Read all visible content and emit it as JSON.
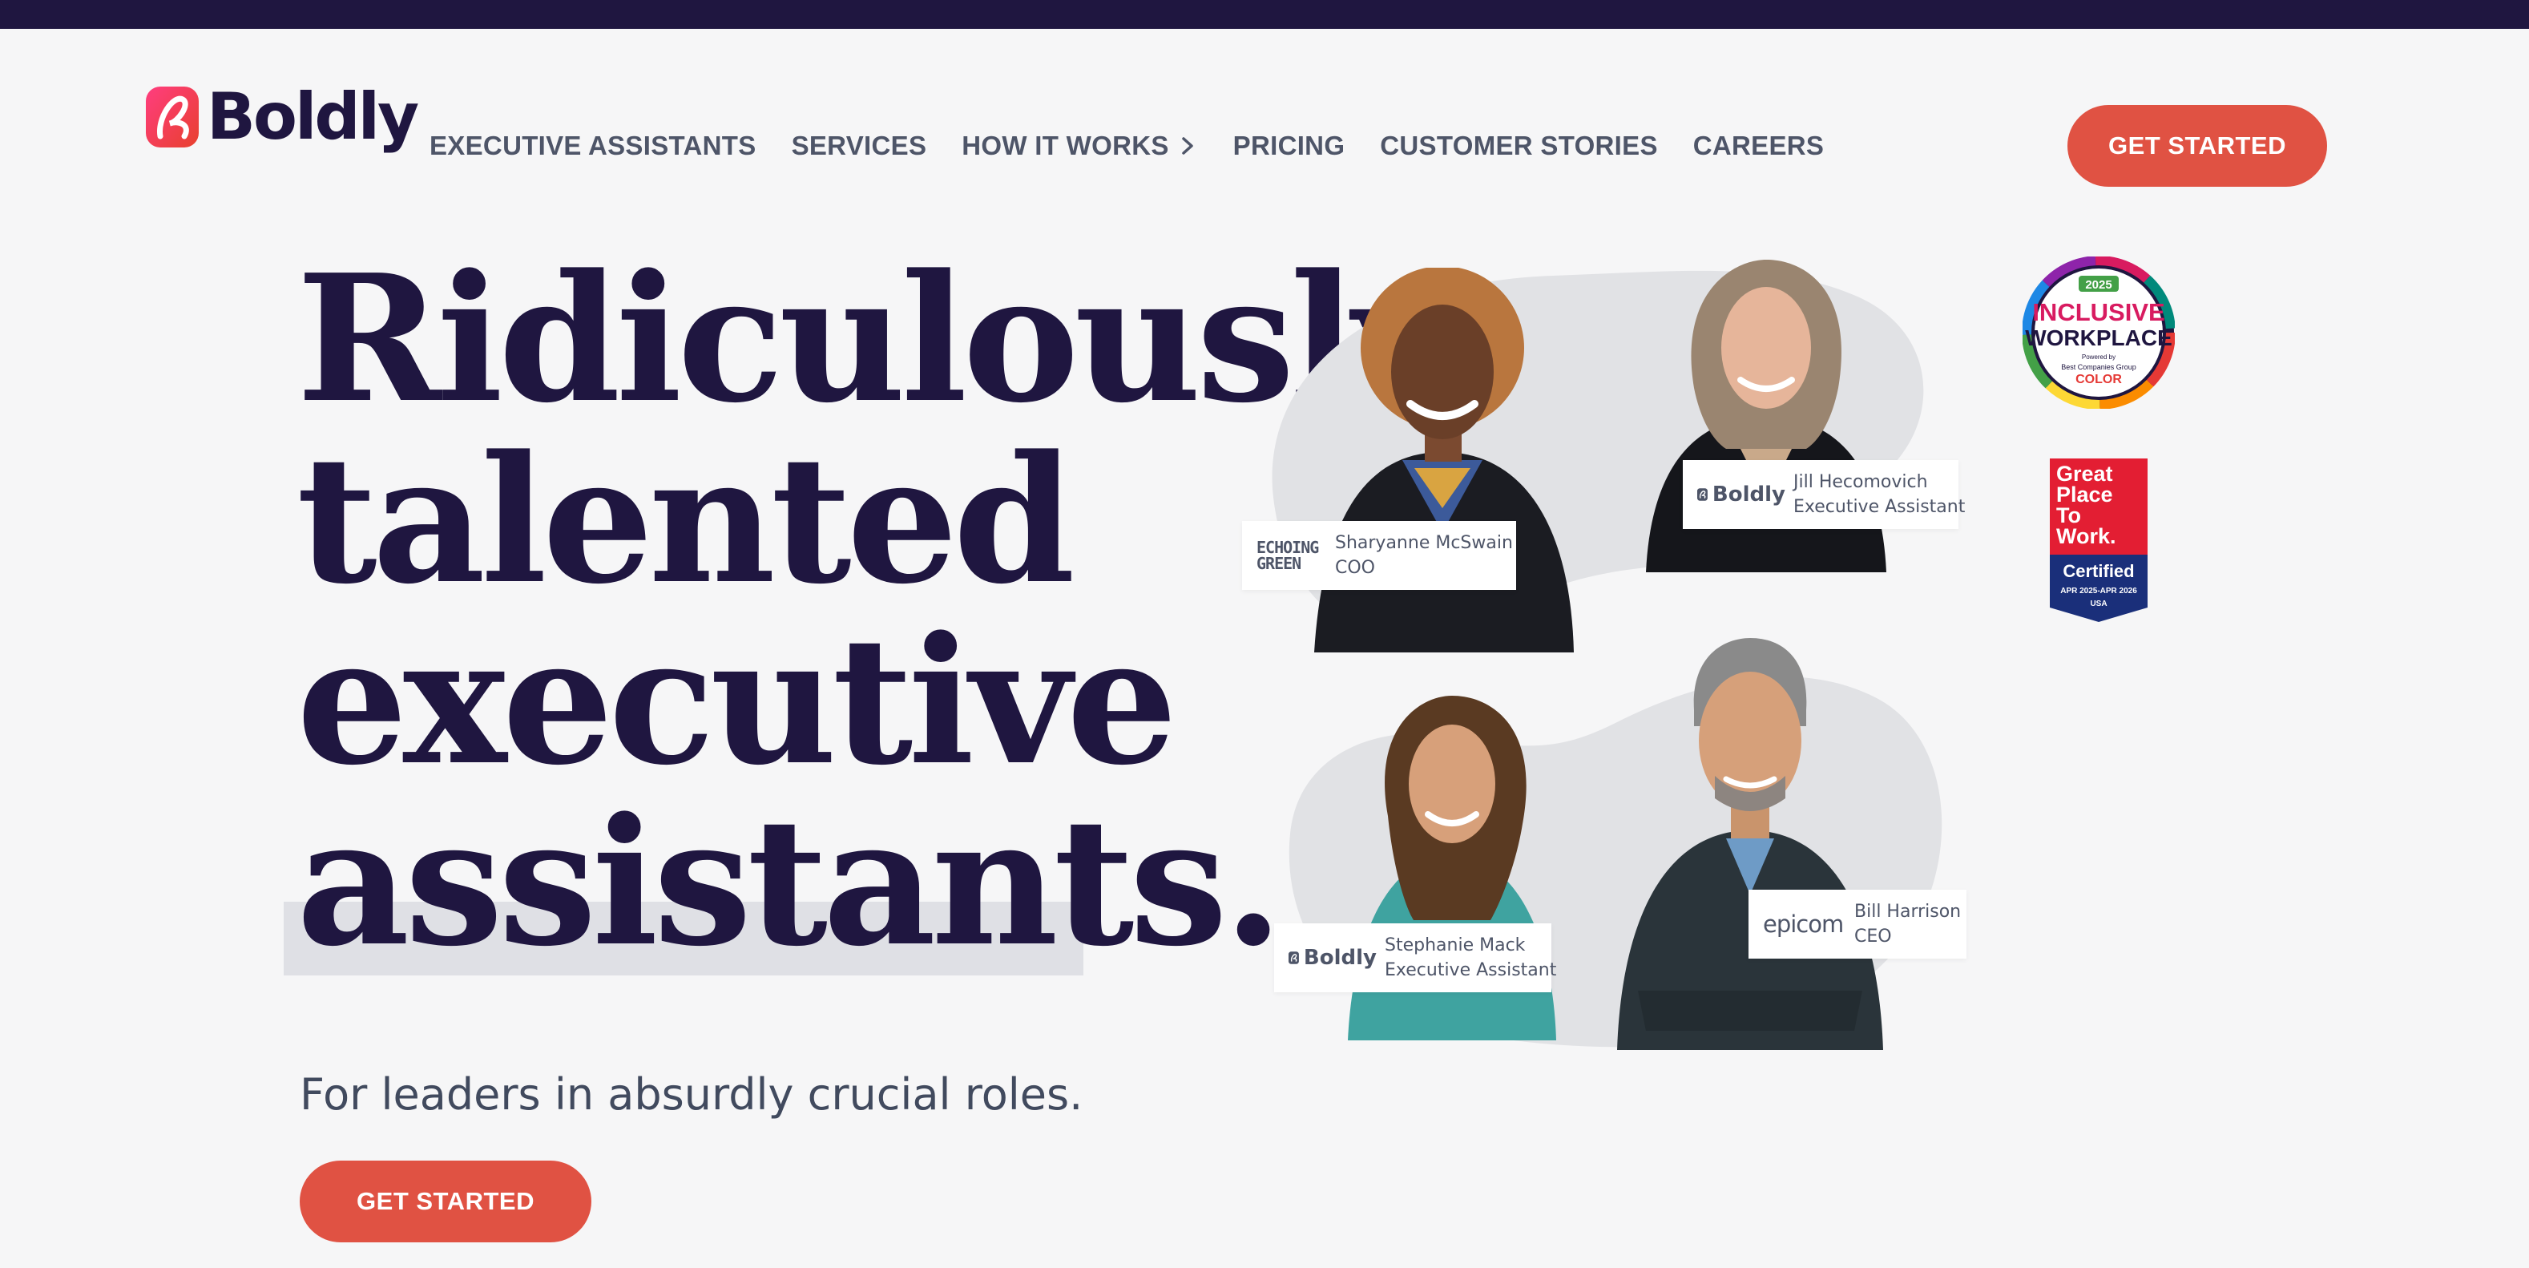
{
  "brand": {
    "name": "Boldly",
    "accent_color": "#e05243",
    "navy_color": "#1f1640"
  },
  "nav": {
    "items": [
      {
        "label": "EXECUTIVE ASSISTANTS"
      },
      {
        "label": "SERVICES"
      },
      {
        "label": "HOW IT WORKS",
        "icon": "chevron-right-icon"
      },
      {
        "label": "PRICING"
      },
      {
        "label": "CUSTOMER STORIES"
      },
      {
        "label": "CAREERS"
      }
    ],
    "cta_label": "GET STARTED"
  },
  "hero": {
    "title_lines": [
      "Ridiculously",
      "talented",
      "executive",
      "assistants."
    ],
    "subtitle": "For leaders in absurdly crucial roles.",
    "cta_label": "GET STARTED"
  },
  "people": [
    {
      "name": "Sharyanne McSwain",
      "role": "COO",
      "company_logo": "ECHOING GREEN"
    },
    {
      "name": "Jill Hecomovich",
      "role": "Executive Assistant",
      "company_logo": "Boldly"
    },
    {
      "name": "Stephanie Mack",
      "role": "Executive Assistant",
      "company_logo": "Boldly"
    },
    {
      "name": "Bill Harrison",
      "role": "CEO",
      "company_logo": "epicom"
    }
  ],
  "badges": {
    "inclusive": {
      "year": "2025",
      "line1": "INCLUSIVE",
      "line2": "WORKPLACE",
      "powered_by": "Powered by",
      "org": "Best Companies Group",
      "org_suffix": "COLOR"
    },
    "gptw": {
      "line1": "Great",
      "line2": "Place",
      "line3": "To",
      "line4": "Work.",
      "certified": "Certified",
      "dates": "APR 2025-APR 2026",
      "country": "USA"
    }
  }
}
